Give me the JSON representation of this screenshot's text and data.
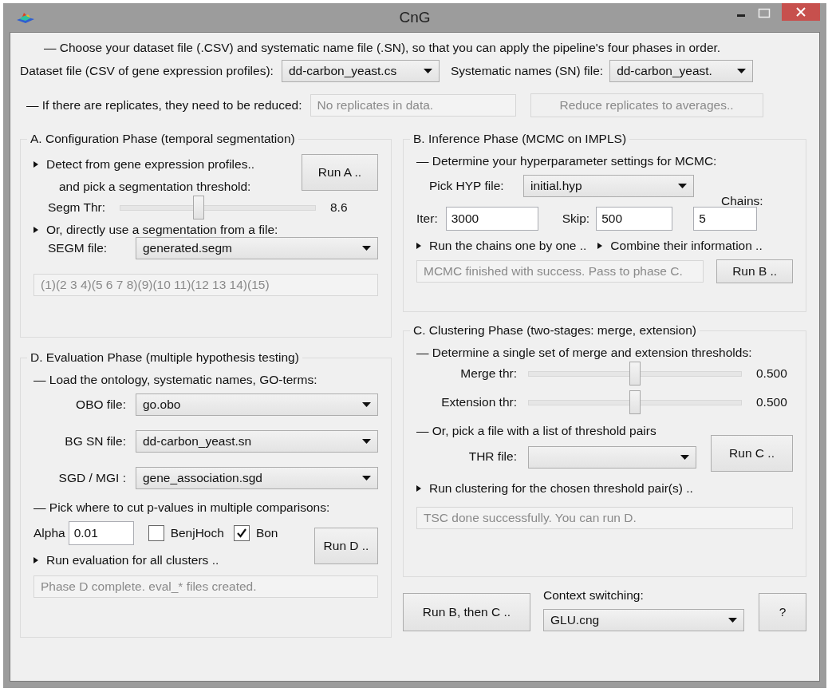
{
  "window": {
    "title": "CnG"
  },
  "intro": "— Choose your dataset file (.CSV) and systematic name file (.SN), so that you can apply the pipeline's four phases in order.",
  "dataset": {
    "label": "Dataset file (CSV of gene expression profiles):",
    "value": "dd-carbon_yeast.cs"
  },
  "sn": {
    "label": "Systematic names (SN) file:",
    "value": "dd-carbon_yeast."
  },
  "replicates": {
    "label": "— If there are replicates, they need to be reduced:",
    "status": "No replicates in data.",
    "button": {
      "label": "Reduce replicates to averages..",
      "disabled": true
    }
  },
  "phase_a": {
    "title": "A. Configuration Phase (temporal segmentation)",
    "detect": "Detect from gene expression profiles..",
    "pick": "and pick a segmentation threshold:",
    "run_button": "Run A ..",
    "slider": {
      "label": "Segm Thr:",
      "level": 0.4,
      "reading": "8.6"
    },
    "file_hint": "Or, directly use a segmentation from a file:",
    "file": {
      "label": "SEGM file:",
      "value": "generated.segm"
    },
    "status": "(1)(2 3 4)(5 6 7 8)(9)(10 11)(12 13 14)(15)"
  },
  "phase_b": {
    "title": "B. Inference Phase (MCMC on IMPLS)",
    "heading": "— Determine your hyperparameter settings for MCMC:",
    "hyp": {
      "label": "Pick HYP file:",
      "value": "initial.hyp"
    },
    "chains_label": "Chains:",
    "iter": {
      "label": "Iter:",
      "value": "3000"
    },
    "skip": {
      "label": "Skip:",
      "value": "500"
    },
    "chains_value": "5",
    "steps": [
      "Run the chains one by one ..",
      "Combine their information .."
    ],
    "status": "MCMC finished with success. Pass to phase C.",
    "run_button": "Run B .."
  },
  "phase_c": {
    "title": "C. Clustering Phase (two-stages: merge, extension)",
    "heading": "— Determine a single set of merge and extension thresholds:",
    "sliders": [
      {
        "label": "Merge thr:",
        "level": 0.5,
        "reading": "0.500"
      },
      {
        "label": "Extension thr:",
        "level": 0.5,
        "reading": "0.500"
      }
    ],
    "thr_heading": "— Or, pick a file with a list of threshold pairs",
    "thr_label": "THR file:",
    "run_button": "Run C ..",
    "step": "Run clustering for the chosen threshold pair(s) ..",
    "status": "TSC done successfully. You can run D."
  },
  "phase_d": {
    "title": "D. Evaluation Phase (multiple hypothesis testing)",
    "heading": "— Load the ontology, systematic names, GO-terms:",
    "files": [
      {
        "label": "OBO file:",
        "value": "go.obo"
      },
      {
        "label": "BG SN file:",
        "value": "dd-carbon_yeast.sn"
      },
      {
        "label": "SGD / MGI :",
        "value": "gene_association.sgd"
      }
    ],
    "cut_heading": "— Pick where to cut p-values in multiple comparisons:",
    "alpha": {
      "label": "Alpha",
      "value": "0.01"
    },
    "checks": [
      {
        "label": "BenjHoch",
        "checked": false
      },
      {
        "label": "Bon",
        "checked": true
      }
    ],
    "run_button": "Run D ..",
    "step": "Run evaluation for all clusters ..",
    "status": "Phase D complete. eval_* files created."
  },
  "footer": {
    "run_bc_button": "Run B, then C  ..",
    "context_label": "Context switching:",
    "context": "GLU.cng",
    "help_button": "?"
  }
}
